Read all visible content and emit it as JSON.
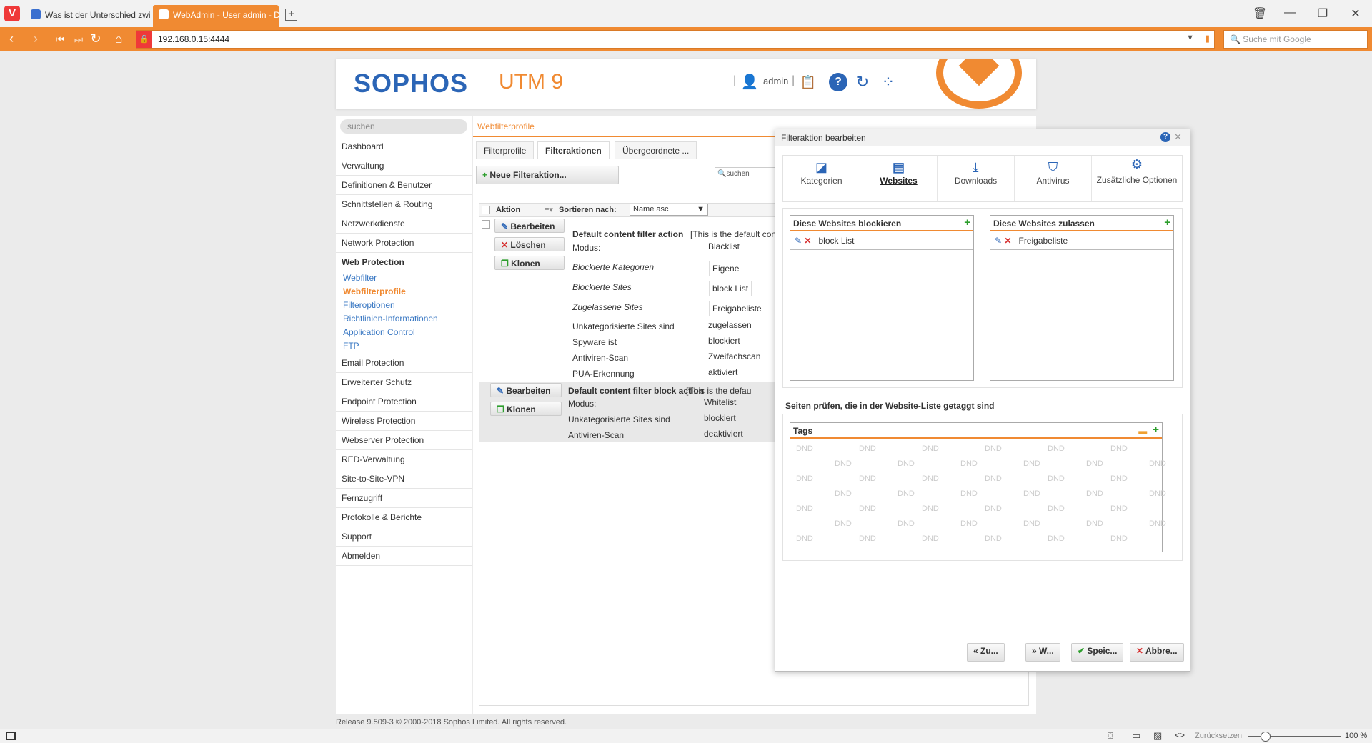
{
  "browser": {
    "tabs": [
      {
        "label": "Was ist der Unterschied zwis",
        "icon": "google-g-icon"
      },
      {
        "label": "WebAdmin - User admin - D",
        "icon": "sophos-tab-icon"
      }
    ],
    "url": "192.168.0.15:4444",
    "search_placeholder": "Suche mit Google",
    "zoom": "100 %",
    "reset_label": "Zurücksetzen"
  },
  "header": {
    "brand": "SOPHOS",
    "product": "UTM 9",
    "user": "admin"
  },
  "sidebar": {
    "search_placeholder": "suchen",
    "items": [
      "Dashboard",
      "Verwaltung",
      "Definitionen & Benutzer",
      "Schnittstellen & Routing",
      "Netzwerkdienste",
      "Network Protection",
      "Web Protection"
    ],
    "web_sub": [
      "Webfilter",
      "Webfilterprofile",
      "Filteroptionen",
      "Richtlinien-Informationen",
      "Application Control",
      "FTP"
    ],
    "items_after": [
      "Email Protection",
      "Erweiterter Schutz",
      "Endpoint Protection",
      "Wireless Protection",
      "Webserver Protection",
      "RED-Verwaltung",
      "Site-to-Site-VPN",
      "Fernzugriff",
      "Protokolle & Berichte",
      "Support",
      "Abmelden"
    ]
  },
  "main": {
    "breadcrumb": "Webfilterprofile",
    "tabs": [
      "Filterprofile",
      "Filteraktionen",
      "Übergeordnete ..."
    ],
    "new_button": "Neue Filteraktion...",
    "search_placeholder": "suchen",
    "list_header_action": "Aktion",
    "sort_label": "Sortieren nach:",
    "sort_value": "Name asc",
    "row1": {
      "edit": "Bearbeiten",
      "delete": "Löschen",
      "clone": "Klonen",
      "title": "Default content filter action",
      "desc": "[This is the default con",
      "fields": [
        {
          "k": "Modus:",
          "v": "Blacklist",
          "italic": false,
          "box": false
        },
        {
          "k": "Blockierte Kategorien",
          "v": "Eigene",
          "italic": true,
          "box": true
        },
        {
          "k": "Blockierte Sites",
          "v": "block List",
          "italic": true,
          "box": true
        },
        {
          "k": "Zugelassene Sites",
          "v": "Freigabeliste",
          "italic": true,
          "box": true
        },
        {
          "k": "Unkategorisierte Sites sind",
          "v": "zugelassen",
          "italic": false,
          "box": false
        },
        {
          "k": "Spyware ist",
          "v": "blockiert",
          "italic": false,
          "box": false
        },
        {
          "k": "Antiviren-Scan",
          "v": "Zweifachscan",
          "italic": false,
          "box": false
        },
        {
          "k": "PUA-Erkennung",
          "v": "aktiviert",
          "italic": false,
          "box": false
        }
      ]
    },
    "row2": {
      "edit": "Bearbeiten",
      "clone": "Klonen",
      "title": "Default content filter block action",
      "desc": "[This is the defau",
      "fields": [
        {
          "k": "Modus:",
          "v": "Whitelist"
        },
        {
          "k": "Unkategorisierte Sites sind",
          "v": "blockiert"
        },
        {
          "k": "Antiviren-Scan",
          "v": "deaktiviert"
        }
      ]
    }
  },
  "dialog": {
    "title": "Filteraktion bearbeiten",
    "nav": [
      "Kategorien",
      "Websites",
      "Downloads",
      "Antivirus",
      "Zusätzliche Optionen"
    ],
    "block_title": "Diese Websites blockieren",
    "block_item": "block List",
    "allow_title": "Diese Websites zulassen",
    "allow_item": "Freigabeliste",
    "tags_heading": "Seiten prüfen, die in der Website-Liste getaggt sind",
    "tags_title": "Tags",
    "dnd": "DND",
    "buttons": [
      "Zu...",
      "W...",
      "Speic...",
      "Abbre..."
    ]
  },
  "footer": "Release 9.509-3  © 2000-2018 Sophos Limited. All rights reserved."
}
